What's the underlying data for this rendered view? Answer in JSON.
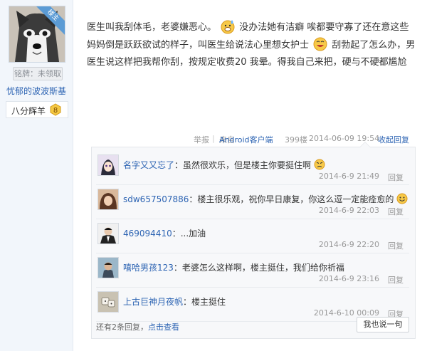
{
  "user": {
    "corner_badge": "楼主",
    "medal_button": "铭牌：未领取",
    "name": "忧郁的波波斯基",
    "level_name": "八分辉羊",
    "level_number": "8"
  },
  "post": {
    "text_part1": "医生叫我刮体毛，老婆嫌恶心。",
    "text_part2": "没办法她有洁癖 唉都要守寡了还在意这些 妈妈倒是跃跃欲试的样子，叫医生给说法心里想女护士",
    "text_part3": "刮勃起了怎么办，男医生说这样把我帮你刮，按规定收费20 我晕。得我自己来把，硬与不硬都尴尬"
  },
  "meta": {
    "report": "举报",
    "source_prefix": "来自",
    "source_android": "Android客户端",
    "floor": "399楼",
    "datetime": "2014-06-09 19:54",
    "collapse": "收起回复"
  },
  "comments": [
    {
      "name": "名字又又忘了",
      "text": "：虽然很欢乐，但是楼主你要挺住啊",
      "emoji": "angry-face-icon",
      "time": "2014-6-9 21:49",
      "reply": "回复"
    },
    {
      "name": "sdw657507886",
      "text": "：楼主很乐观，祝你早日康复，你这么逗一定能痊愈的",
      "emoji": "smile-face-icon",
      "time": "2014-6-9 22:03",
      "reply": "回复"
    },
    {
      "name": "469094410",
      "text": "：...加油",
      "emoji": "",
      "time": "2014-6-9 22:20",
      "reply": "回复"
    },
    {
      "name": "嘻哈男孩123",
      "text": "：老婆怎么这样啊，楼主挺住，我们给你祈福",
      "emoji": "",
      "time": "2014-6-9 23:16",
      "reply": "回复"
    },
    {
      "name": "上古巨神月夜帆",
      "text": "：楼主挺住",
      "emoji": "",
      "time": "2014-6-10 00:09",
      "reply": "回复"
    }
  ],
  "footer": {
    "more_text": "还有2条回复，",
    "view_link": "点击查看",
    "say_button": "我也说一句"
  },
  "colors": {
    "link": "#2d64b3",
    "badge": "#5b9bd5",
    "meta": "#999999"
  }
}
